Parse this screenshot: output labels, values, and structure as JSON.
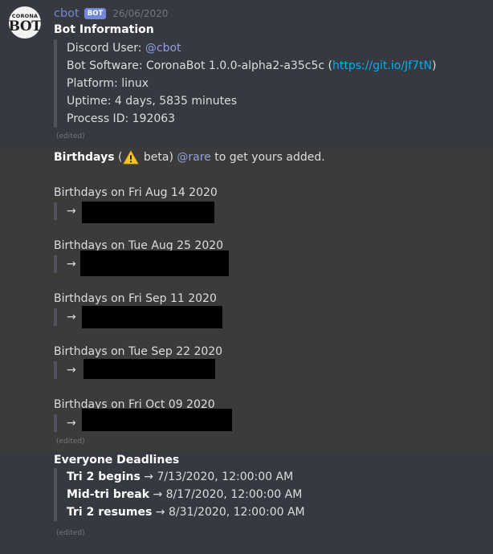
{
  "message1": {
    "avatar_top": "CORONA",
    "avatar_bottom": "BOT",
    "author": "cbot",
    "badge": "BOT",
    "timestamp": "26/06/2020",
    "title": "Bot Information",
    "discord_user_label": "Discord User: ",
    "discord_user": "@cbot",
    "software_label": "Bot Software: CoronaBot 1.0.0-alpha2-a35c5c (",
    "software_link": "https://git.io/Jf7tN",
    "software_suffix": ")",
    "platform": "Platform: linux",
    "uptime": "Uptime: 4 days, 5835 minutes",
    "process_id": "Process ID: 192063",
    "edited": "(edited)"
  },
  "message2": {
    "heading_bold": "Birthdays",
    "heading_open": " (",
    "heading_beta": " beta) ",
    "heading_mention": "@rare",
    "heading_rest": " to get yours added.",
    "arrow": "→",
    "dates": [
      "Birthdays on Fri Aug 14 2020",
      "Birthdays on Tue Aug 25 2020",
      "Birthdays on Fri Sep 11 2020",
      "Birthdays on Tue Sep 22 2020",
      "Birthdays on Fri Oct 09 2020"
    ],
    "edited": "(edited)"
  },
  "message3": {
    "title": "Everyone Deadlines",
    "deadlines": [
      {
        "label": "Tri 2 begins",
        "value": " → 7/13/2020, 12:00:00 AM"
      },
      {
        "label": "Mid-tri break",
        "value": " → 8/17/2020, 12:00:00 AM"
      },
      {
        "label": "Tri 2 resumes",
        "value": " → 8/31/2020, 12:00:00 AM"
      }
    ],
    "edited": "(edited)"
  },
  "colors": {
    "background": "#36393f",
    "highlight": "#3d3b39",
    "author": "#7289da",
    "link": "#00b0f4",
    "mention": "#8ea1e1"
  }
}
